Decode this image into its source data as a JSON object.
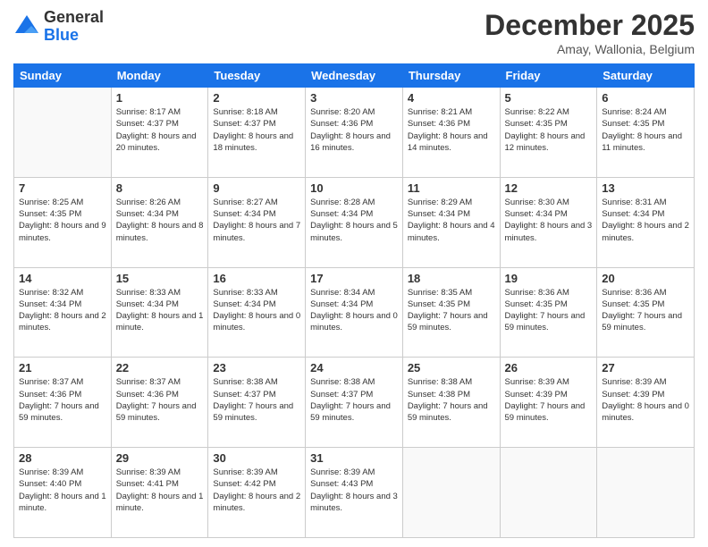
{
  "logo": {
    "general": "General",
    "blue": "Blue"
  },
  "header": {
    "month": "December 2025",
    "location": "Amay, Wallonia, Belgium"
  },
  "days_of_week": [
    "Sunday",
    "Monday",
    "Tuesday",
    "Wednesday",
    "Thursday",
    "Friday",
    "Saturday"
  ],
  "weeks": [
    [
      {
        "day": "",
        "sunrise": "",
        "sunset": "",
        "daylight": ""
      },
      {
        "day": "1",
        "sunrise": "Sunrise: 8:17 AM",
        "sunset": "Sunset: 4:37 PM",
        "daylight": "Daylight: 8 hours and 20 minutes."
      },
      {
        "day": "2",
        "sunrise": "Sunrise: 8:18 AM",
        "sunset": "Sunset: 4:37 PM",
        "daylight": "Daylight: 8 hours and 18 minutes."
      },
      {
        "day": "3",
        "sunrise": "Sunrise: 8:20 AM",
        "sunset": "Sunset: 4:36 PM",
        "daylight": "Daylight: 8 hours and 16 minutes."
      },
      {
        "day": "4",
        "sunrise": "Sunrise: 8:21 AM",
        "sunset": "Sunset: 4:36 PM",
        "daylight": "Daylight: 8 hours and 14 minutes."
      },
      {
        "day": "5",
        "sunrise": "Sunrise: 8:22 AM",
        "sunset": "Sunset: 4:35 PM",
        "daylight": "Daylight: 8 hours and 12 minutes."
      },
      {
        "day": "6",
        "sunrise": "Sunrise: 8:24 AM",
        "sunset": "Sunset: 4:35 PM",
        "daylight": "Daylight: 8 hours and 11 minutes."
      }
    ],
    [
      {
        "day": "7",
        "sunrise": "Sunrise: 8:25 AM",
        "sunset": "Sunset: 4:35 PM",
        "daylight": "Daylight: 8 hours and 9 minutes."
      },
      {
        "day": "8",
        "sunrise": "Sunrise: 8:26 AM",
        "sunset": "Sunset: 4:34 PM",
        "daylight": "Daylight: 8 hours and 8 minutes."
      },
      {
        "day": "9",
        "sunrise": "Sunrise: 8:27 AM",
        "sunset": "Sunset: 4:34 PM",
        "daylight": "Daylight: 8 hours and 7 minutes."
      },
      {
        "day": "10",
        "sunrise": "Sunrise: 8:28 AM",
        "sunset": "Sunset: 4:34 PM",
        "daylight": "Daylight: 8 hours and 5 minutes."
      },
      {
        "day": "11",
        "sunrise": "Sunrise: 8:29 AM",
        "sunset": "Sunset: 4:34 PM",
        "daylight": "Daylight: 8 hours and 4 minutes."
      },
      {
        "day": "12",
        "sunrise": "Sunrise: 8:30 AM",
        "sunset": "Sunset: 4:34 PM",
        "daylight": "Daylight: 8 hours and 3 minutes."
      },
      {
        "day": "13",
        "sunrise": "Sunrise: 8:31 AM",
        "sunset": "Sunset: 4:34 PM",
        "daylight": "Daylight: 8 hours and 2 minutes."
      }
    ],
    [
      {
        "day": "14",
        "sunrise": "Sunrise: 8:32 AM",
        "sunset": "Sunset: 4:34 PM",
        "daylight": "Daylight: 8 hours and 2 minutes."
      },
      {
        "day": "15",
        "sunrise": "Sunrise: 8:33 AM",
        "sunset": "Sunset: 4:34 PM",
        "daylight": "Daylight: 8 hours and 1 minute."
      },
      {
        "day": "16",
        "sunrise": "Sunrise: 8:33 AM",
        "sunset": "Sunset: 4:34 PM",
        "daylight": "Daylight: 8 hours and 0 minutes."
      },
      {
        "day": "17",
        "sunrise": "Sunrise: 8:34 AM",
        "sunset": "Sunset: 4:34 PM",
        "daylight": "Daylight: 8 hours and 0 minutes."
      },
      {
        "day": "18",
        "sunrise": "Sunrise: 8:35 AM",
        "sunset": "Sunset: 4:35 PM",
        "daylight": "Daylight: 7 hours and 59 minutes."
      },
      {
        "day": "19",
        "sunrise": "Sunrise: 8:36 AM",
        "sunset": "Sunset: 4:35 PM",
        "daylight": "Daylight: 7 hours and 59 minutes."
      },
      {
        "day": "20",
        "sunrise": "Sunrise: 8:36 AM",
        "sunset": "Sunset: 4:35 PM",
        "daylight": "Daylight: 7 hours and 59 minutes."
      }
    ],
    [
      {
        "day": "21",
        "sunrise": "Sunrise: 8:37 AM",
        "sunset": "Sunset: 4:36 PM",
        "daylight": "Daylight: 7 hours and 59 minutes."
      },
      {
        "day": "22",
        "sunrise": "Sunrise: 8:37 AM",
        "sunset": "Sunset: 4:36 PM",
        "daylight": "Daylight: 7 hours and 59 minutes."
      },
      {
        "day": "23",
        "sunrise": "Sunrise: 8:38 AM",
        "sunset": "Sunset: 4:37 PM",
        "daylight": "Daylight: 7 hours and 59 minutes."
      },
      {
        "day": "24",
        "sunrise": "Sunrise: 8:38 AM",
        "sunset": "Sunset: 4:37 PM",
        "daylight": "Daylight: 7 hours and 59 minutes."
      },
      {
        "day": "25",
        "sunrise": "Sunrise: 8:38 AM",
        "sunset": "Sunset: 4:38 PM",
        "daylight": "Daylight: 7 hours and 59 minutes."
      },
      {
        "day": "26",
        "sunrise": "Sunrise: 8:39 AM",
        "sunset": "Sunset: 4:39 PM",
        "daylight": "Daylight: 7 hours and 59 minutes."
      },
      {
        "day": "27",
        "sunrise": "Sunrise: 8:39 AM",
        "sunset": "Sunset: 4:39 PM",
        "daylight": "Daylight: 8 hours and 0 minutes."
      }
    ],
    [
      {
        "day": "28",
        "sunrise": "Sunrise: 8:39 AM",
        "sunset": "Sunset: 4:40 PM",
        "daylight": "Daylight: 8 hours and 1 minute."
      },
      {
        "day": "29",
        "sunrise": "Sunrise: 8:39 AM",
        "sunset": "Sunset: 4:41 PM",
        "daylight": "Daylight: 8 hours and 1 minute."
      },
      {
        "day": "30",
        "sunrise": "Sunrise: 8:39 AM",
        "sunset": "Sunset: 4:42 PM",
        "daylight": "Daylight: 8 hours and 2 minutes."
      },
      {
        "day": "31",
        "sunrise": "Sunrise: 8:39 AM",
        "sunset": "Sunset: 4:43 PM",
        "daylight": "Daylight: 8 hours and 3 minutes."
      },
      {
        "day": "",
        "sunrise": "",
        "sunset": "",
        "daylight": ""
      },
      {
        "day": "",
        "sunrise": "",
        "sunset": "",
        "daylight": ""
      },
      {
        "day": "",
        "sunrise": "",
        "sunset": "",
        "daylight": ""
      }
    ]
  ]
}
